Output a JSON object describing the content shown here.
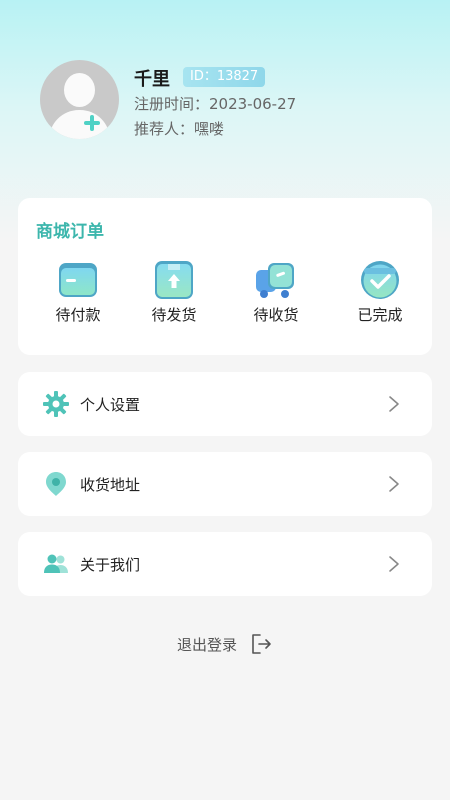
{
  "profile": {
    "name": "千里",
    "id_label": "ID：13827",
    "register_time": "注册时间：2023-06-27",
    "referrer": "推荐人：嘿喽"
  },
  "orders": {
    "title": "商城订单",
    "items": [
      {
        "label": "待付款",
        "icon": "wallet-icon"
      },
      {
        "label": "待发货",
        "icon": "package-icon"
      },
      {
        "label": "待收货",
        "icon": "delivery-truck-icon"
      },
      {
        "label": "已完成",
        "icon": "check-circle-icon"
      }
    ]
  },
  "menu": [
    {
      "label": "个人设置",
      "icon": "gear-icon"
    },
    {
      "label": "收货地址",
      "icon": "location-pin-icon"
    },
    {
      "label": "关于我们",
      "icon": "users-icon"
    }
  ],
  "logout": {
    "label": "退出登录",
    "icon": "logout-icon"
  },
  "colors": {
    "accent": "#3cb6ac",
    "icon_teal": "#4fc3b8",
    "badge": "#8fd7ea"
  }
}
